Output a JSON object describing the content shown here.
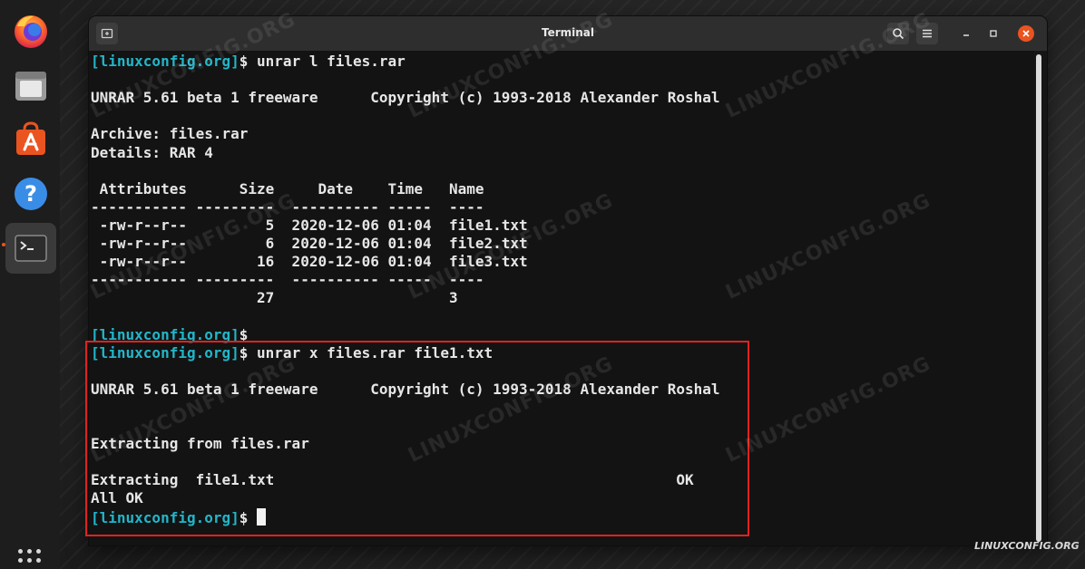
{
  "window": {
    "title": "Terminal"
  },
  "dock": {
    "items": [
      "firefox-icon",
      "files-icon",
      "software-icon",
      "help-icon",
      "terminal-icon"
    ],
    "show_apps_icon": "grid-icon"
  },
  "terminal": {
    "prompt_color": "#22b6c9",
    "lines": [
      {
        "prompt": "[linuxconfig.org]",
        "text": "$ unrar l files.rar"
      },
      {
        "prompt": "",
        "text": ""
      },
      {
        "prompt": "",
        "text": "UNRAR 5.61 beta 1 freeware      Copyright (c) 1993-2018 Alexander Roshal"
      },
      {
        "prompt": "",
        "text": ""
      },
      {
        "prompt": "",
        "text": "Archive: files.rar"
      },
      {
        "prompt": "",
        "text": "Details: RAR 4"
      },
      {
        "prompt": "",
        "text": ""
      },
      {
        "prompt": "",
        "text": " Attributes      Size     Date    Time   Name"
      },
      {
        "prompt": "",
        "text": "----------- ---------  ---------- -----  ----"
      },
      {
        "prompt": "",
        "text": " -rw-r--r--         5  2020-12-06 01:04  file1.txt"
      },
      {
        "prompt": "",
        "text": " -rw-r--r--         6  2020-12-06 01:04  file2.txt"
      },
      {
        "prompt": "",
        "text": " -rw-r--r--        16  2020-12-06 01:04  file3.txt"
      },
      {
        "prompt": "",
        "text": "----------- ---------  ---------- -----  ----"
      },
      {
        "prompt": "",
        "text": "                   27                    3"
      },
      {
        "prompt": "",
        "text": ""
      },
      {
        "prompt": "[linuxconfig.org]",
        "text": "$"
      },
      {
        "prompt": "[linuxconfig.org]",
        "text": "$ unrar x files.rar file1.txt"
      },
      {
        "prompt": "",
        "text": ""
      },
      {
        "prompt": "",
        "text": "UNRAR 5.61 beta 1 freeware      Copyright (c) 1993-2018 Alexander Roshal"
      },
      {
        "prompt": "",
        "text": ""
      },
      {
        "prompt": "",
        "text": ""
      },
      {
        "prompt": "",
        "text": "Extracting from files.rar"
      },
      {
        "prompt": "",
        "text": ""
      },
      {
        "prompt": "",
        "text": "Extracting  file1.txt                                              OK"
      },
      {
        "prompt": "",
        "text": "All OK"
      },
      {
        "prompt": "[linuxconfig.org]",
        "text": "$ "
      }
    ]
  },
  "watermark_text": "LINUXCONFIG.ORG",
  "logo_text": "LINUXCONFIG.ORG",
  "colors": {
    "highlight_border": "#e0221f",
    "accent": "#e95420"
  }
}
